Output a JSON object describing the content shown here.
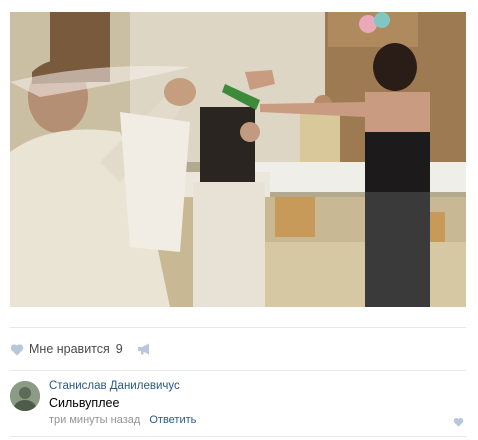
{
  "post": {
    "likes": {
      "label": "Мне нравится",
      "count": "9"
    }
  },
  "comment": {
    "author": "Станислав Данилевичус",
    "text": "Сильвуплее",
    "time": "три минуты назад",
    "reply_label": "Ответить"
  },
  "icons": {
    "like": "heart-icon",
    "share": "megaphone-icon",
    "comment_like": "heart-icon"
  },
  "colors": {
    "link": "#2a5885",
    "icon": "#b8c7d9",
    "meta": "#939393",
    "divider": "#e7e8ec"
  }
}
